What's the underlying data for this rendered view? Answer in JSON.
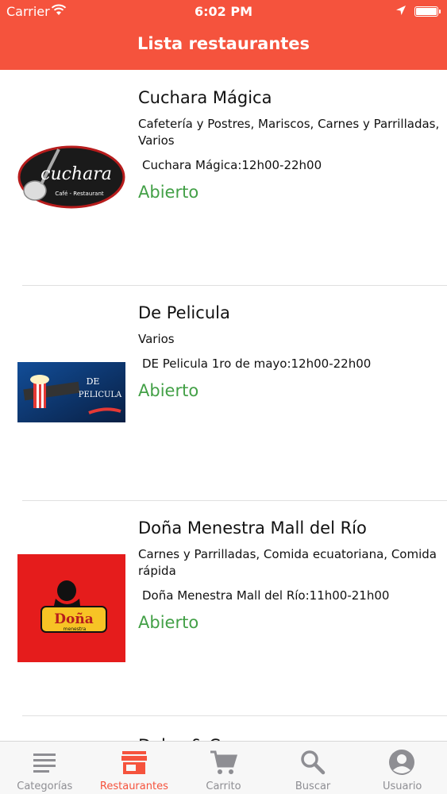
{
  "status_bar": {
    "carrier": "Carrier",
    "time": "6:02 PM"
  },
  "header": {
    "title": "Lista restaurantes"
  },
  "restaurants": [
    {
      "name": "Cuchara Mágica",
      "categories": "Cafetería y Postres, Mariscos, Carnes y Parrilladas, Varios",
      "hours": "Cuchara Mágica:12h00-22h00",
      "status": "Abierto",
      "logo_text": "cuchara",
      "logo_subtext": "Café - Restaurant"
    },
    {
      "name": "De Pelicula",
      "categories": "Varios",
      "hours": "DE Pelicula 1ro de mayo:12h00-22h00",
      "status": "Abierto",
      "logo_text": "DE",
      "logo_subtext": "PELICULA"
    },
    {
      "name": "Doña Menestra Mall del Río",
      "categories": "Carnes y Parrilladas, Comida ecuatoriana, Comida rápida",
      "hours": "Doña Menestra Mall del Río:11h00-21h00",
      "status": "Abierto",
      "logo_text": "Doña",
      "logo_subtext": "menestra"
    }
  ],
  "next_item_partial": "Dolce & C",
  "tabbar": {
    "tabs": [
      {
        "label": "Categorías",
        "icon": "list-icon"
      },
      {
        "label": "Restaurantes",
        "icon": "store-icon"
      },
      {
        "label": "Carrito",
        "icon": "cart-icon"
      },
      {
        "label": "Buscar",
        "icon": "search-icon"
      },
      {
        "label": "Usuario",
        "icon": "user-icon"
      }
    ],
    "active": "Restaurantes"
  },
  "colors": {
    "accent": "#f5533d",
    "open": "#43a047",
    "tab_inactive": "#8e8e93"
  }
}
